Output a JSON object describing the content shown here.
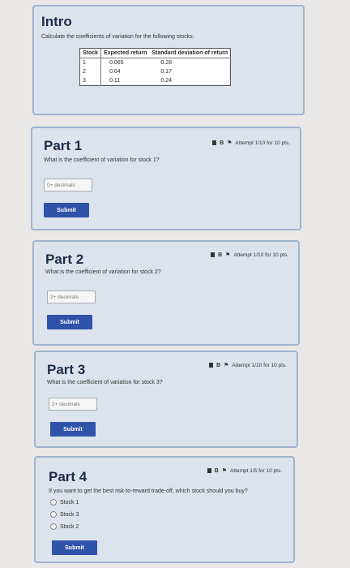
{
  "intro": {
    "title": "Intro",
    "description": "Calculate the coefficients of variation for the following stocks:",
    "table": {
      "headers": [
        "Stock",
        "Expected return",
        "Standard deviation of return"
      ],
      "rows": [
        [
          "1",
          "0.065",
          "0.28"
        ],
        [
          "2",
          "0.04",
          "0.17"
        ],
        [
          "3",
          "0.11",
          "0.24"
        ]
      ]
    }
  },
  "parts": [
    {
      "title": "Part 1",
      "question": "What is the coefficient of variation for stock 1?",
      "attempt": "Attempt 1/10 for 10 pts.",
      "placeholder": "0+ decimals",
      "submit": "Submit"
    },
    {
      "title": "Part 2",
      "question": "What is the coefficient of variation for stock 2?",
      "attempt": "Attempt 1/10 for 10 pts.",
      "placeholder": "2+ decimals",
      "submit": "Submit"
    },
    {
      "title": "Part 3",
      "question": "What is the coefficient of variation for stock 3?",
      "attempt": "Attempt 1/10 for 10 pts.",
      "placeholder": "2+ decimals",
      "submit": "Submit"
    },
    {
      "title": "Part 4",
      "question": "If you want to get the best risk-to-reward trade-off, which stock should you buy?",
      "attempt": "Attempt 1/5 for 10 pts.",
      "options": [
        "Stock 1",
        "Stock 3",
        "Stock 2"
      ],
      "submit": "Submit"
    }
  ],
  "icons": {
    "toolbar_b": "B",
    "flag": "flag-icon"
  },
  "colors": {
    "card_bg": "#dde3ec",
    "card_border": "#9fb3cf",
    "submit_bg": "#2f53a8",
    "title_color": "#1c2b4a"
  }
}
